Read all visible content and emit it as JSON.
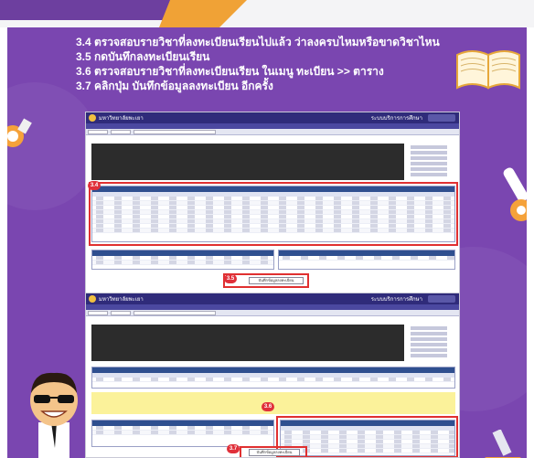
{
  "steps": [
    "3.4 ตรวจสอบรายวิชาที่ลงทะเบียนเรียนไปแล้ว ว่าลงครบไหมหรือขาดวิชาไหน",
    "3.5 กดบันทึกลงทะเบียนเรียน",
    "3.6 ตรวจสอบรายวิชาที่ลงทะเบียนเรียน ในเมนู ทะเบียน >> ตาราง",
    "3.7 คลิกปุ่ม บันทึกข้อมูลลงทะเบียน อีกครั้ง"
  ],
  "screens": [
    {
      "university": "มหาวิทยาลัยพะเยา",
      "right_title": "ระบบบริการการศึกษา",
      "badges": [
        "3.4",
        "3.5"
      ],
      "button_label": "บันทึกข้อมูลลงทะเบียน"
    },
    {
      "university": "มหาวิทยาลัยพะเยา",
      "right_title": "ระบบบริการการศึกษา",
      "badges": [
        "3.6",
        "3.7"
      ],
      "button_label": "บันทึกข้อมูลลงทะเบียน"
    }
  ],
  "colors": {
    "background_purple": "#7a46b0",
    "accent_orange": "#f0a236",
    "badge_red": "#e0303a",
    "header_navy": "#2f2b7a"
  }
}
